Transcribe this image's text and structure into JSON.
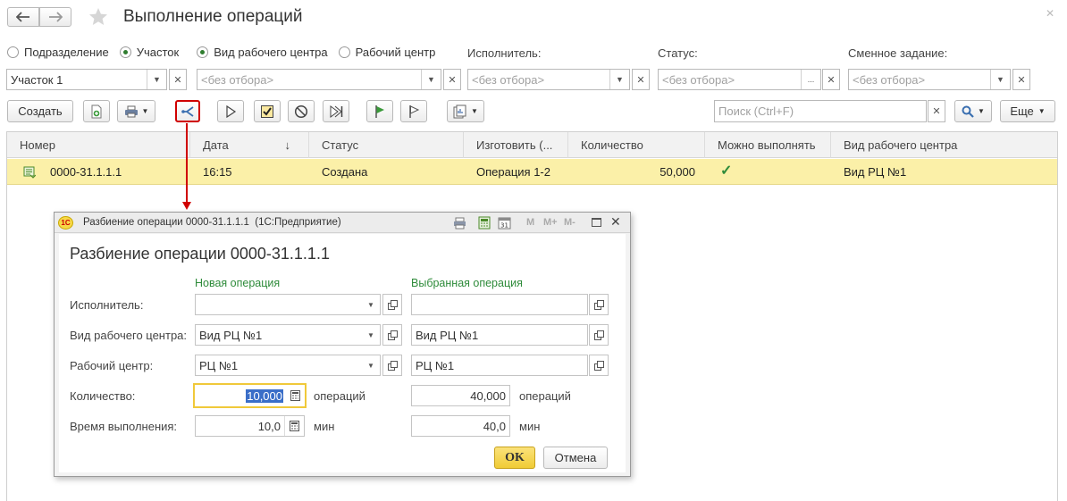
{
  "window": {
    "title": "Выполнение операций"
  },
  "filters": {
    "radios": [
      {
        "label": "Подразделение",
        "checked": false
      },
      {
        "label": "Участок",
        "checked": true
      },
      {
        "label": "Вид рабочего центра",
        "checked": true
      },
      {
        "label": "Рабочий центр",
        "checked": false
      }
    ],
    "executor_label": "Исполнитель:",
    "status_label": "Статус:",
    "shift_label": "Сменное задание:",
    "section_value": "Участок 1",
    "placeholder": "<без отбора>",
    "ellipsis": "..."
  },
  "toolbar": {
    "create_label": "Создать",
    "search_placeholder": "Поиск (Ctrl+F)",
    "more_label": "Еще"
  },
  "table": {
    "headers": [
      "Номер",
      "Дата",
      "Статус",
      "Изготовить (...",
      "Количество",
      "Можно выполнять",
      "Вид рабочего центра"
    ],
    "sort_icon": "↓",
    "rows": [
      {
        "number": "0000-31.1.1.1",
        "date": "16:15",
        "status": "Создана",
        "make": "Операция 1-2",
        "qty": "50,000",
        "can_run": "✓",
        "wc_type": "Вид РЦ №1"
      }
    ]
  },
  "dialog": {
    "window_title": "Разбиение операции 0000-31.1.1.1  (1С:Предприятие)",
    "logo": "1С",
    "heading": "Разбиение операции 0000-31.1.1.1",
    "col_new": "Новая операция",
    "col_selected": "Выбранная операция",
    "labels": {
      "executor": "Исполнитель:",
      "wc_type": "Вид рабочего центра:",
      "wc": "Рабочий центр:",
      "qty": "Количество:",
      "time": "Время выполнения:"
    },
    "new": {
      "executor": "",
      "wc_type": "Вид РЦ №1",
      "wc": "РЦ №1",
      "qty": "10,000",
      "time": "10,0"
    },
    "selected": {
      "executor": "",
      "wc_type": "Вид РЦ №1",
      "wc": "РЦ №1",
      "qty": "40,000",
      "time": "40,0"
    },
    "qty_unit": "операций",
    "time_unit": "мин",
    "title_btns": [
      "M",
      "M+",
      "M-"
    ],
    "ok_label": "OK",
    "cancel_label": "Отмена"
  },
  "colors": {
    "accent_green": "#2e8b3a",
    "row_highlight": "#fbf0a8",
    "callout_red": "#d00000",
    "ok_button": "#f5d84a"
  }
}
